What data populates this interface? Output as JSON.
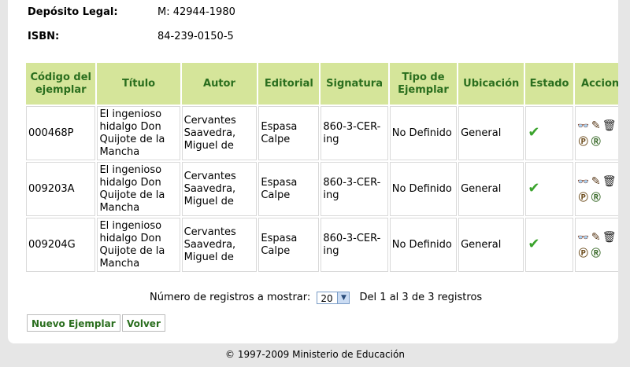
{
  "meta": {
    "deposito_label": "Depósito Legal:",
    "deposito_value": "M: 42944-1980",
    "isbn_label": "ISBN:",
    "isbn_value": "84-239-0150-5"
  },
  "table": {
    "headers": [
      "Código del ejemplar",
      "Título",
      "Autor",
      "Editorial",
      "Signatura",
      "Tipo de Ejemplar",
      "Ubicación",
      "Estado",
      "Acciones"
    ],
    "rows": [
      {
        "codigo": "000468P",
        "titulo": "El ingenioso hidalgo Don Quijote de la Mancha",
        "autor": "Cervantes Saavedra, Miguel de",
        "editorial": "Espasa Calpe",
        "signatura": "860-3-CER-ing",
        "tipo": "No Definido",
        "ubicacion": "General",
        "estado": "✔"
      },
      {
        "codigo": "009203A",
        "titulo": "El ingenioso hidalgo Don Quijote de la Mancha",
        "autor": "Cervantes Saavedra, Miguel de",
        "editorial": "Espasa Calpe",
        "signatura": "860-3-CER-ing",
        "tipo": "No Definido",
        "ubicacion": "General",
        "estado": "✔"
      },
      {
        "codigo": "009204G",
        "titulo": "El ingenioso hidalgo Don Quijote de la Mancha",
        "autor": "Cervantes Saavedra, Miguel de",
        "editorial": "Espasa Calpe",
        "signatura": "860-3-CER-ing",
        "tipo": "No Definido",
        "ubicacion": "General",
        "estado": "✔"
      }
    ],
    "action_icons": [
      "view-icon",
      "edit-icon",
      "delete-icon",
      "loan-icon",
      "reserve-icon"
    ]
  },
  "pager": {
    "label": "Número de registros a mostrar:",
    "selected": "20",
    "summary": "Del 1 al 3 de 3 registros"
  },
  "buttons": {
    "nuevo": "Nuevo Ejemplar",
    "volver": "Volver"
  },
  "footer": "© 1997-2009 Ministerio de Educación",
  "colors": {
    "header_bg": "#d5e59a",
    "header_text": "#2a6e1e",
    "check": "#3aa32c"
  }
}
